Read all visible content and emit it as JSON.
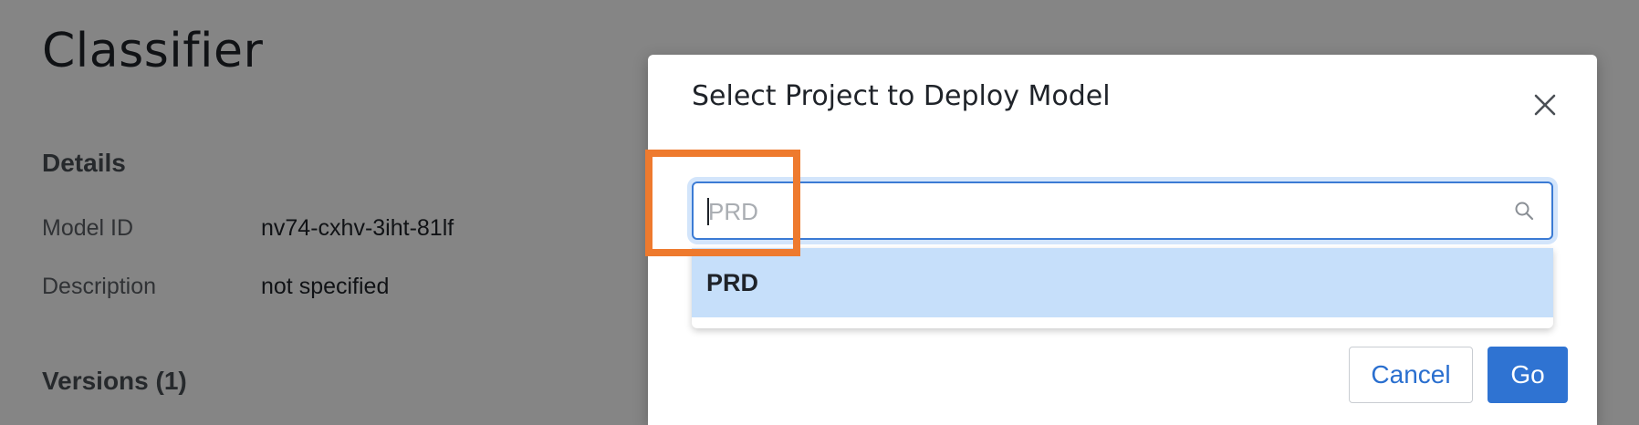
{
  "page": {
    "title": "Classifier",
    "details_heading": "Details",
    "details": [
      {
        "label": "Model ID",
        "value": "nv74-cxhv-3iht-81lf"
      },
      {
        "label": "Description",
        "value": "not specified"
      }
    ],
    "versions_heading": "Versions (1)"
  },
  "modal": {
    "title": "Select Project to Deploy Model",
    "search": {
      "value": "",
      "placeholder": "PRD"
    },
    "options": [
      "PRD"
    ],
    "cancel_label": "Cancel",
    "go_label": "Go"
  },
  "colors": {
    "primary": "#2f73d2",
    "option_highlight": "#c6dffa",
    "annotation": "#ee7a2e"
  },
  "icons": {
    "close": "close-icon",
    "search": "search-icon"
  }
}
